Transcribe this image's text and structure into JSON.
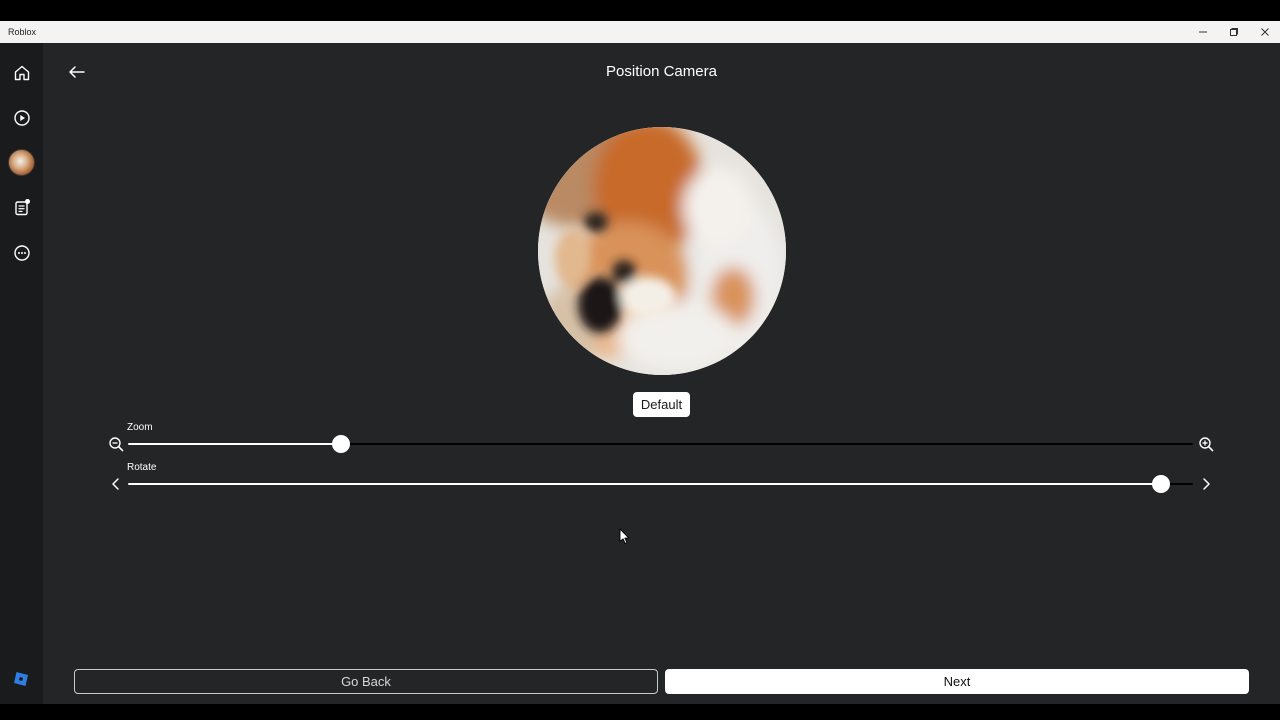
{
  "window": {
    "title": "Roblox",
    "controls": [
      "minimize",
      "restore",
      "close"
    ]
  },
  "sidebar": {
    "items": [
      {
        "name": "home",
        "icon": "home-icon"
      },
      {
        "name": "discover",
        "icon": "play-icon"
      },
      {
        "name": "avatar",
        "icon": "avatar-icon"
      },
      {
        "name": "notifications",
        "icon": "notes-icon"
      },
      {
        "name": "more",
        "icon": "more-icon"
      }
    ],
    "logo_icon": "roblox-logo-icon"
  },
  "header": {
    "back_icon": "arrow-left-icon",
    "title": "Position Camera"
  },
  "preview": {
    "default_label": "Default"
  },
  "sliders": {
    "zoom": {
      "label": "Zoom",
      "value": 0.2,
      "left_icon": "zoom-out-icon",
      "right_icon": "zoom-in-icon"
    },
    "rotate": {
      "label": "Rotate",
      "value": 0.97,
      "left_icon": "chevron-left-icon",
      "right_icon": "chevron-right-icon"
    }
  },
  "footer": {
    "go_back_label": "Go Back",
    "next_label": "Next"
  },
  "colors": {
    "background": "#232527",
    "sidebar": "#191b1d",
    "accent": "#ffffff"
  }
}
